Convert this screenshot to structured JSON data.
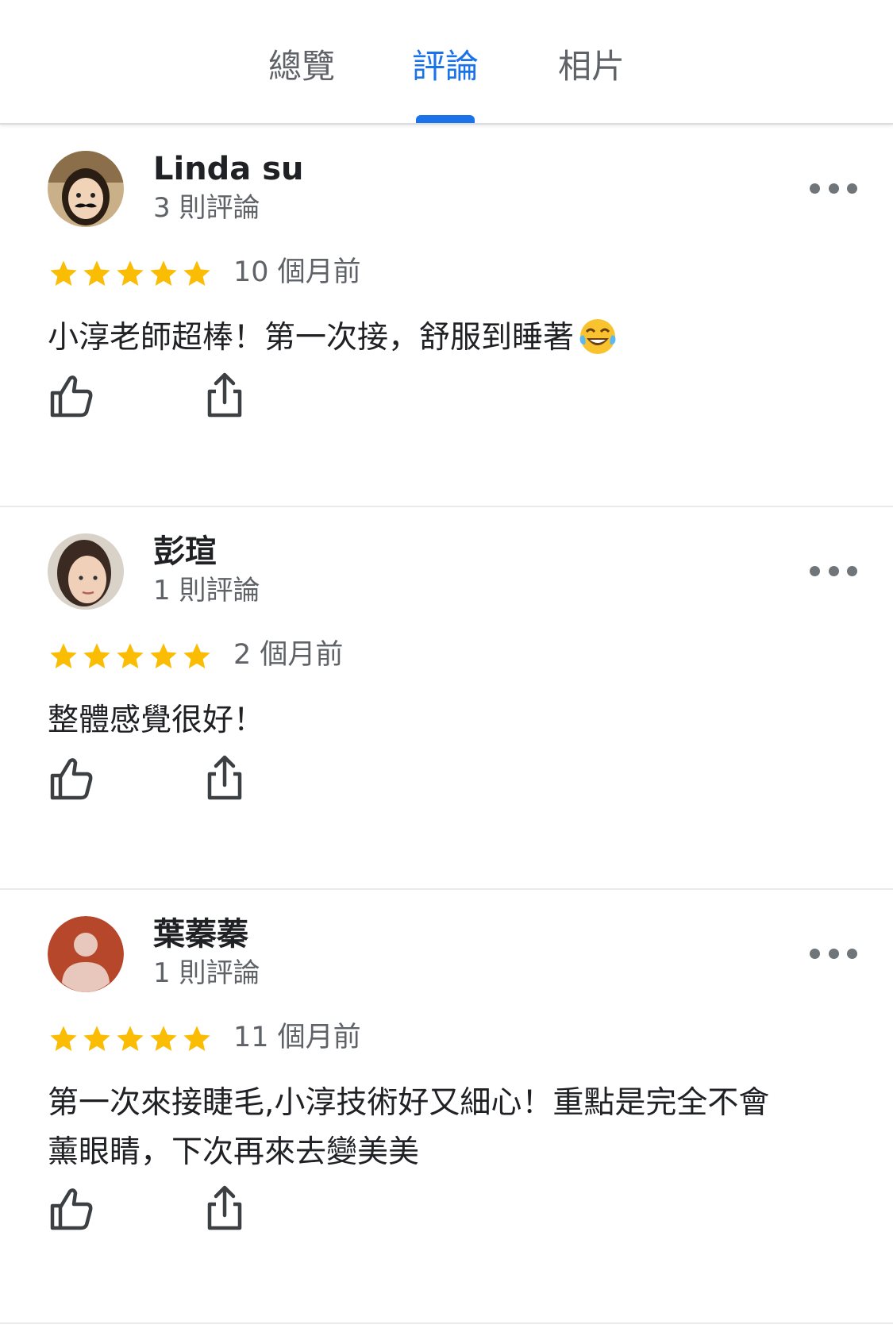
{
  "tabs": [
    {
      "label": "總覽",
      "active": false
    },
    {
      "label": "評論",
      "active": true
    },
    {
      "label": "相片",
      "active": false
    }
  ],
  "colors": {
    "accent": "#1a73e8",
    "star": "#fbbc04",
    "secondary_text": "#5f6368",
    "avatar_placeholder": "#b7472a"
  },
  "reviews": [
    {
      "author": "Linda su",
      "review_count": "3 則評論",
      "rating": 5,
      "date": "10 個月前",
      "text": "小淳老師超棒！第一次接，舒服到睡著",
      "emoji": "face-with-tears-of-joy-icon"
    },
    {
      "author": "彭瑄",
      "review_count": "1 則評論",
      "rating": 5,
      "date": "2 個月前",
      "text": "整體感覺很好！"
    },
    {
      "author": "葉蓁蓁",
      "review_count": "1 則評論",
      "rating": 5,
      "date": "11 個月前",
      "text": "第一次來接睫毛,小淳技術好又細心！重點是完全不會\n薰眼睛，下次再來去變美美"
    }
  ]
}
